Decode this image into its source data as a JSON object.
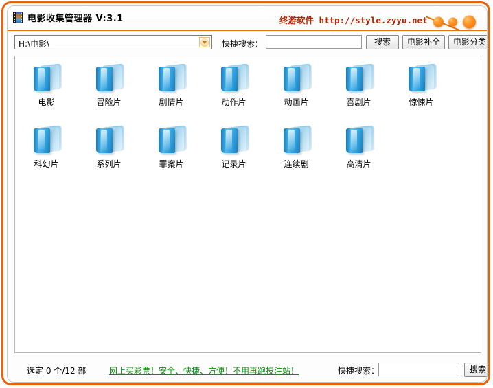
{
  "window": {
    "title": "电影收集管理器 V:3.1",
    "title_icon": "film-strip-icon",
    "brand_cn": "终游软件",
    "brand_url": "http://style.zyyu.net",
    "accent_color": "#E8620C",
    "title_accent_color": "#F07000",
    "controls": [
      {
        "name": "minimize",
        "label": ""
      },
      {
        "name": "maximize",
        "label": ""
      },
      {
        "name": "close",
        "label": ""
      }
    ]
  },
  "toolbar": {
    "path_value": "H:\\电影\\",
    "dropdown_icon": "chevron-down-icon",
    "quick_search_label": "快捷搜索：",
    "search_value": "",
    "search_placeholder": "",
    "buttons": [
      {
        "name": "search",
        "label": "搜索"
      },
      {
        "name": "movie-complete",
        "label": "电影补全"
      },
      {
        "name": "movie-category",
        "label": "电影分类"
      }
    ]
  },
  "content": {
    "icon_name": "folder-icon",
    "rows": [
      [
        {
          "label": "电影"
        },
        {
          "label": "冒险片"
        },
        {
          "label": "剧情片"
        },
        {
          "label": "动作片"
        },
        {
          "label": "动画片"
        },
        {
          "label": "喜剧片"
        },
        {
          "label": "惊悚片"
        }
      ],
      [
        {
          "label": "科幻片"
        },
        {
          "label": "系列片"
        },
        {
          "label": "罪案片"
        },
        {
          "label": "记录片"
        },
        {
          "label": "连续剧"
        },
        {
          "label": "高清片"
        }
      ]
    ]
  },
  "statusbar": {
    "selection_text": "选定 0 个/12 部",
    "selected_count": 0,
    "total_count": 12,
    "ad_link_text": "网上买彩票！安全、快捷、方便！不用再跑投注站！",
    "ad_link_color": "#128A12",
    "quick_search_label": "快捷搜索：",
    "search_value": "",
    "search_placeholder": "",
    "search_button_label": "搜索"
  }
}
